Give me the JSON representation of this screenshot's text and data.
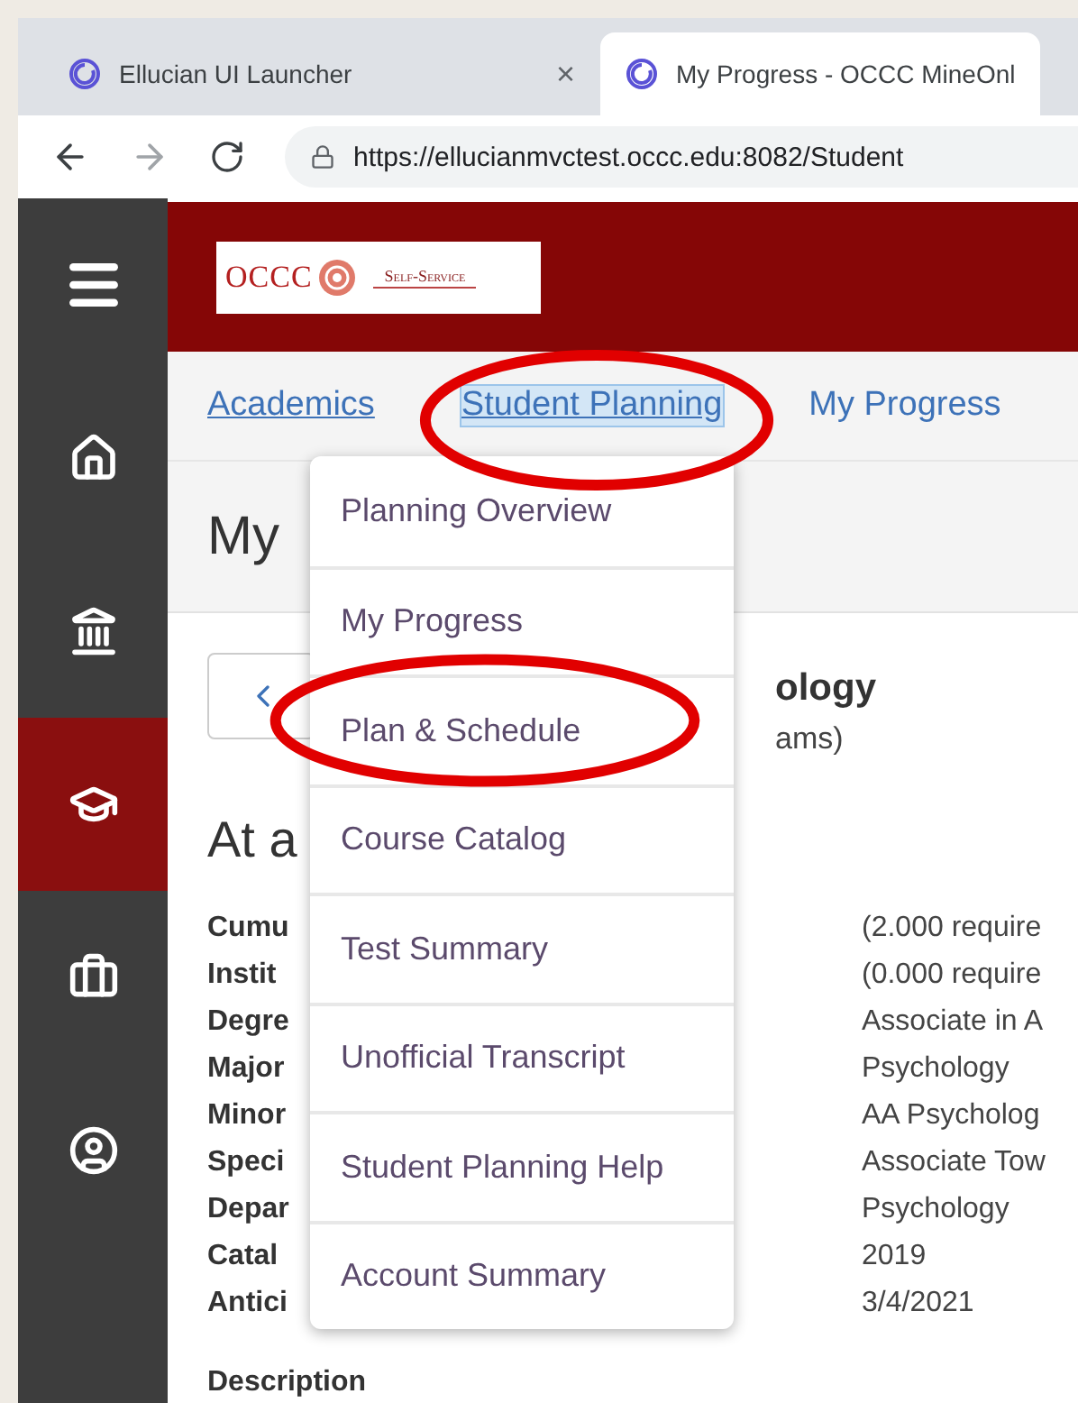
{
  "browser": {
    "tabs": [
      {
        "title": "Ellucian UI Launcher",
        "close": "×",
        "selected": false
      },
      {
        "title": "My Progress - OCCC MineOnl",
        "selected": true
      }
    ],
    "url": "https://ellucianmvctest.occc.edu:8082/Student"
  },
  "sidebar": {
    "items": [
      {
        "selected": false
      },
      {
        "selected": false
      },
      {
        "selected": false
      },
      {
        "selected": true
      },
      {
        "selected": false
      },
      {
        "selected": false
      }
    ]
  },
  "header": {
    "logo": {
      "name": "OCCC",
      "tagline": "Self-Service"
    }
  },
  "nav": {
    "links": [
      {
        "label": "Academics",
        "selected": false,
        "circled": false
      },
      {
        "label": "Student Planning",
        "selected": true,
        "circled": true
      },
      {
        "label": "My Progress",
        "selected": false,
        "circled": false
      }
    ]
  },
  "page": {
    "title": "My",
    "program": {
      "name": "ology",
      "note": "ams)"
    },
    "section_title": "At a",
    "details": [
      {
        "label": "Cumu",
        "value": "(2.000 require"
      },
      {
        "label": "Instit",
        "value": "(0.000 require"
      },
      {
        "label": "Degre",
        "value": "Associate in A"
      },
      {
        "label": "Major",
        "value": "Psychology"
      },
      {
        "label": "Minor",
        "value": "AA Psycholog"
      },
      {
        "label": "Speci",
        "value": "Associate Tow"
      },
      {
        "label": "Depar",
        "value": "Psychology"
      },
      {
        "label": "Catal",
        "value": "2019"
      },
      {
        "label": "Antici",
        "value": "3/4/2021"
      }
    ],
    "description_heading": "Description"
  },
  "menu": {
    "items": [
      {
        "label": "Planning Overview",
        "circled": false
      },
      {
        "label": "My Progress",
        "circled": false
      },
      {
        "label": "Plan & Schedule",
        "circled": true
      },
      {
        "label": "Course Catalog",
        "circled": false
      },
      {
        "label": "Test Summary",
        "circled": false
      },
      {
        "label": "Unofficial Transcript",
        "circled": false
      },
      {
        "label": "Student Planning Help",
        "circled": false
      },
      {
        "label": "Account Summary",
        "circled": false
      }
    ]
  }
}
